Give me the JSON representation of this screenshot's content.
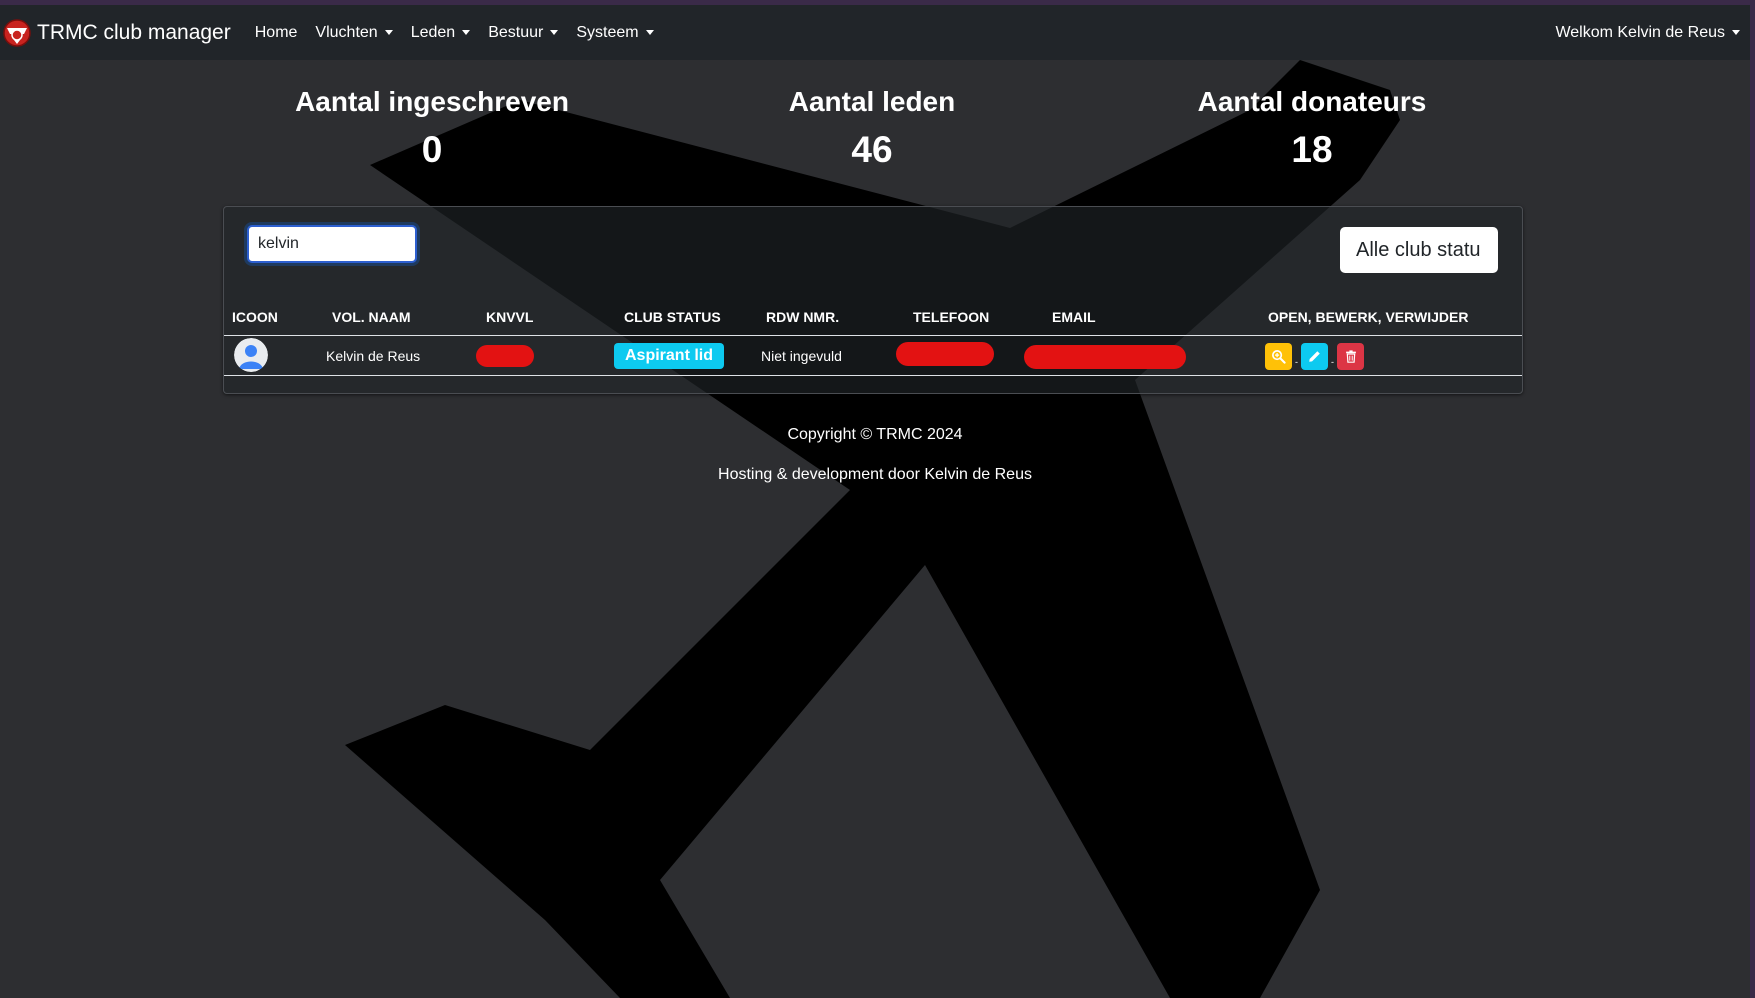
{
  "navbar": {
    "brand": "TRMC club manager",
    "items": [
      {
        "label": "Home",
        "dropdown": false
      },
      {
        "label": "Vluchten",
        "dropdown": true
      },
      {
        "label": "Leden",
        "dropdown": true
      },
      {
        "label": "Bestuur",
        "dropdown": true
      },
      {
        "label": "Systeem",
        "dropdown": true
      }
    ],
    "user_label": "Welkom Kelvin de Reus"
  },
  "stats": [
    {
      "title": "Aantal ingeschreven",
      "value": "0"
    },
    {
      "title": "Aantal leden",
      "value": "46"
    },
    {
      "title": "Aantal donateurs",
      "value": "18"
    }
  ],
  "search": {
    "value": "kelvin"
  },
  "filter": {
    "selected": "Alle club statu"
  },
  "table": {
    "headers": [
      "ICOON",
      "VOL. NAAM",
      "KNVVL",
      "CLUB STATUS",
      "RDW NMR.",
      "TELEFOON",
      "EMAIL",
      "OPEN, BEWERK, VERWIJDER"
    ],
    "rows": [
      {
        "name": "Kelvin de Reus",
        "club_status": "Aspirant lid",
        "rdw": "Niet ingevuld",
        "separator": "-"
      }
    ]
  },
  "footer": {
    "copyright": "Copyright © TRMC 2024",
    "hosting": "Hosting & development door Kelvin de Reus"
  },
  "colors": {
    "background": "#2d2e31",
    "navbar": "#212529",
    "badge_info": "#0dcaf0",
    "btn_warning": "#ffc107",
    "btn_info": "#0dcaf0",
    "btn_danger": "#dc3545",
    "redaction": "#e31212"
  },
  "icons": {
    "brand": "club-logo-icon",
    "avatar": "user-avatar-icon",
    "open": "zoom-in-icon",
    "edit": "pencil-icon",
    "delete": "trash-icon"
  }
}
